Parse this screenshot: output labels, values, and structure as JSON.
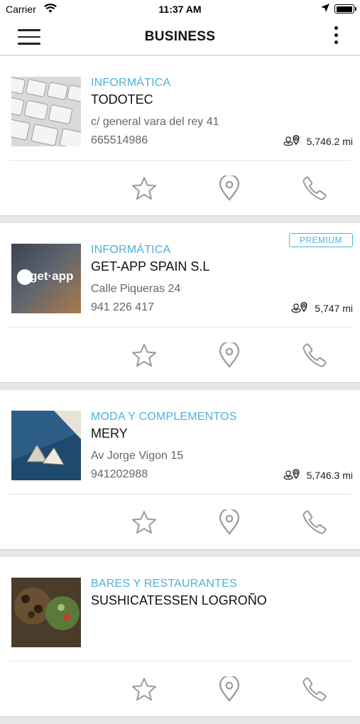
{
  "status_bar": {
    "carrier": "Carrier",
    "time": "11:37 AM"
  },
  "app_bar": {
    "title": "BUSINESS"
  },
  "businesses": [
    {
      "category": "INFORMÁTICA",
      "name": "TODOTEC",
      "address": "c/ general vara del rey 41",
      "phone": "665514986",
      "distance": "5,746.2 mi",
      "premium": "",
      "thumb": "keyboard"
    },
    {
      "category": "INFORMÁTICA",
      "name": "GET-APP SPAIN S.L",
      "address": "Calle Piqueras 24",
      "phone": "941 226 417",
      "distance": "5,747 mi",
      "premium": "PREMIUM",
      "thumb": "getapp-logo",
      "thumb_text": "get·app"
    },
    {
      "category": "MODA Y COMPLEMENTOS",
      "name": "MERY",
      "address": "Av Jorge Vigon 15",
      "phone": "941202988",
      "distance": "5,746.3 mi",
      "premium": "",
      "thumb": "jewelry"
    },
    {
      "category": "BARES Y RESTAURANTES",
      "name": "SUSHICATESSEN LOGROÑO",
      "address": "",
      "phone": "",
      "distance": "",
      "premium": "",
      "thumb": "food"
    }
  ],
  "colors": {
    "accent": "#4ab3d9",
    "icon_gray": "#9a9a9a"
  }
}
